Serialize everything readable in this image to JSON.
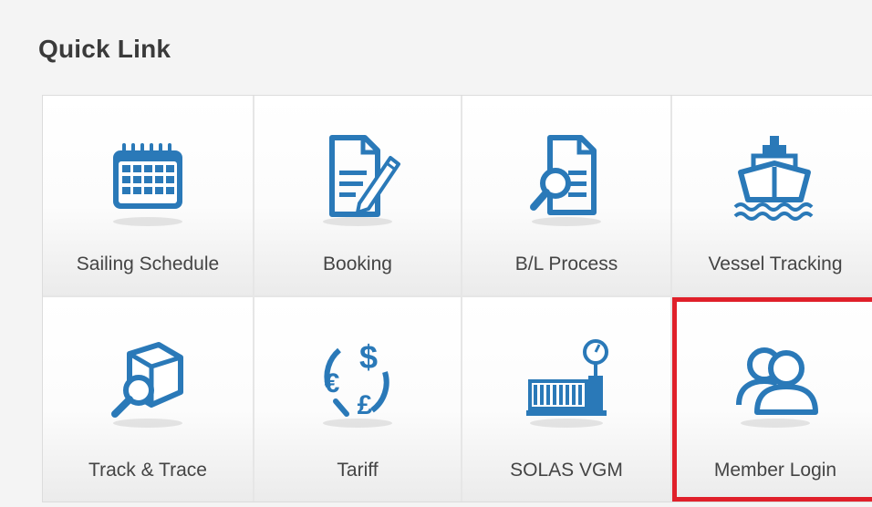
{
  "panel": {
    "title": "Quick Link"
  },
  "colors": {
    "icon_blue": "#2a79b8",
    "highlight_red": "#e0202a"
  },
  "tiles": [
    {
      "label": "Sailing Schedule",
      "icon": "calendar-icon"
    },
    {
      "label": "Booking",
      "icon": "document-pencil-icon"
    },
    {
      "label": "B/L Process",
      "icon": "document-magnifier-icon"
    },
    {
      "label": "Vessel Tracking",
      "icon": "ship-icon"
    },
    {
      "label": "Track & Trace",
      "icon": "box-magnifier-icon"
    },
    {
      "label": "Tariff",
      "icon": "currency-exchange-icon"
    },
    {
      "label": "SOLAS VGM",
      "icon": "container-scale-icon"
    },
    {
      "label": "Member Login",
      "icon": "users-icon",
      "highlighted": true
    }
  ]
}
